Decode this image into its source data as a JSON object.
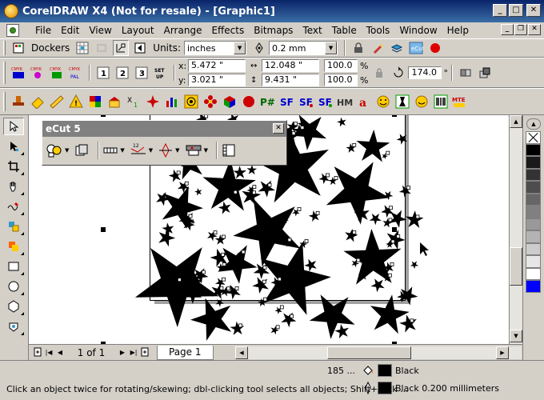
{
  "window": {
    "title": "CorelDRAW X4 (Not for resale) - [Graphic1]"
  },
  "menu": [
    "File",
    "Edit",
    "View",
    "Layout",
    "Arrange",
    "Effects",
    "Bitmaps",
    "Text",
    "Table",
    "Tools",
    "Window",
    "Help"
  ],
  "toolbar": {
    "dockers_label": "Dockers",
    "units_label": "Units:",
    "units_value": "inches",
    "nudge_value": "0.2 mm"
  },
  "position": {
    "x_label": "x:",
    "x_value": "5.472 \"",
    "y_label": "y:",
    "y_value": "3.021 \"",
    "w_value": "12.048 \"",
    "h_value": "9.431 \"",
    "scale_x": "100.0",
    "scale_y": "100.0",
    "pct": "%",
    "angle": "174.0",
    "deg": "°"
  },
  "docker": {
    "title": "eCut 5"
  },
  "nav": {
    "page_counter": "1 of 1",
    "page_tab": "Page 1"
  },
  "status": {
    "object_count": "185 ...",
    "fill_color": "Black",
    "outline_info": "Black  0.200 millimeters",
    "hint": "Click an object twice for rotating/skewing; dbl-clicking tool selects all objects; Shift+click ..."
  },
  "palette": {
    "colors": [
      "#000000",
      "#1a1a1a",
      "#333333",
      "#4d4d4d",
      "#666666",
      "#808080",
      "#999999",
      "#b3b3b3",
      "#cccccc",
      "#e6e6e6",
      "#ffffff",
      "#0000ff"
    ]
  }
}
